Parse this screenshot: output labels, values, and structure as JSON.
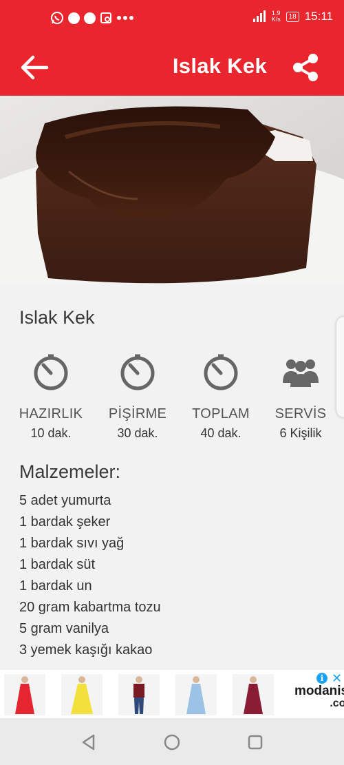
{
  "status_bar": {
    "network_speed_value": "1.9",
    "network_speed_unit": "K/s",
    "battery": "18",
    "time": "15:11"
  },
  "app_bar": {
    "title": "Islak Kek"
  },
  "recipe": {
    "title": "Islak Kek",
    "stats": [
      {
        "label": "HAZIRLIK",
        "value": "10 dak.",
        "icon": "timer-icon"
      },
      {
        "label": "PİŞİRME",
        "value": "30 dak.",
        "icon": "timer-icon"
      },
      {
        "label": "TOPLAM",
        "value": "40 dak.",
        "icon": "timer-icon"
      },
      {
        "label": "SERVİS",
        "value": "6 Kişilik",
        "icon": "people-icon"
      }
    ],
    "ingredients_title": "Malzemeler:",
    "ingredients": [
      "5 adet yumurta",
      "1 bardak şeker",
      "1 bardak sıvı yağ",
      "1 bardak süt",
      "1 bardak un",
      "20 gram kabartma tozu",
      "5 gram vanilya",
      "3 yemek kaşığı kakao"
    ]
  },
  "ad": {
    "brand": "modanisa",
    "brand_suffix": ".com",
    "info_glyph": "i",
    "close_glyph": "✕",
    "dress_colors": [
      "#e5252f",
      "#f2e13c",
      "#7a1a22",
      "#9cc3e6",
      "#8a1d35"
    ]
  },
  "colors": {
    "accent": "#e9262d",
    "icon_gray": "#666666"
  }
}
